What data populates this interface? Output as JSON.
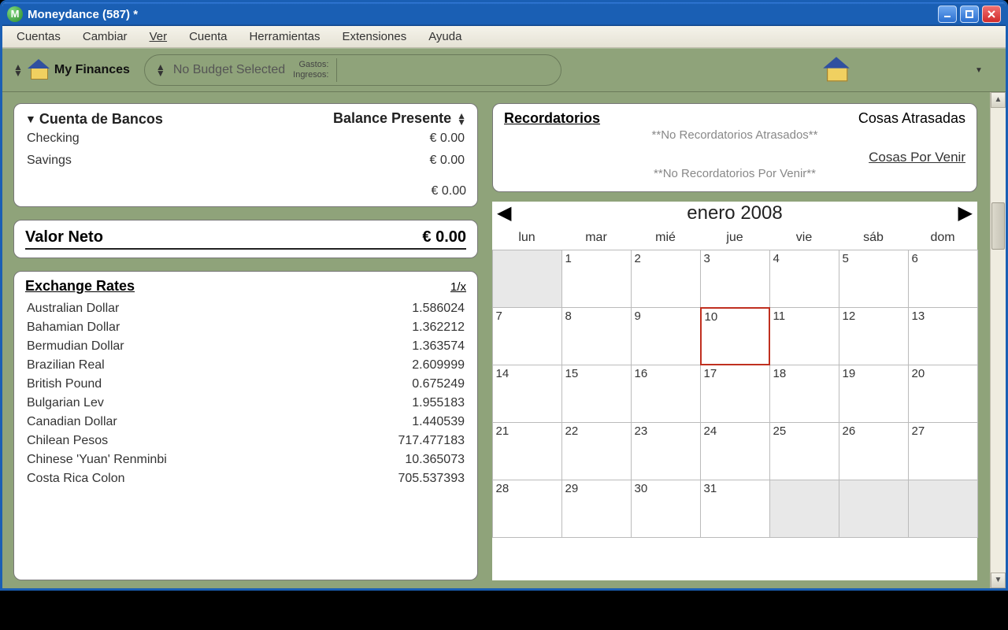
{
  "window": {
    "app_icon_letter": "M",
    "title": "Moneydance (587) *"
  },
  "menu": [
    "Cuentas",
    "Cambiar",
    "Ver",
    "Cuenta",
    "Herramientas",
    "Extensiones",
    "Ayuda"
  ],
  "toolbar": {
    "home_label": "My Finances",
    "budget_selected": "No Budget Selected",
    "gastos_label": "Gastos:",
    "ingresos_label": "Ingresos:"
  },
  "accounts_panel": {
    "title": "Cuenta de Bancos",
    "balance_header": "Balance Presente",
    "rows": [
      {
        "name": "Checking",
        "balance": "€ 0.00"
      },
      {
        "name": "Savings",
        "balance": "€ 0.00"
      }
    ],
    "total": "€ 0.00"
  },
  "networth_panel": {
    "label": "Valor Neto",
    "value": "€ 0.00"
  },
  "fx_panel": {
    "title": "Exchange Rates",
    "inverse_label": "1/x",
    "rows": [
      {
        "name": "Australian Dollar",
        "rate": "1.586024"
      },
      {
        "name": "Bahamian Dollar",
        "rate": "1.362212"
      },
      {
        "name": "Bermudian Dollar",
        "rate": "1.363574"
      },
      {
        "name": "Brazilian Real",
        "rate": "2.609999"
      },
      {
        "name": "British Pound",
        "rate": "0.675249"
      },
      {
        "name": "Bulgarian Lev",
        "rate": "1.955183"
      },
      {
        "name": "Canadian Dollar",
        "rate": "1.440539"
      },
      {
        "name": "Chilean Pesos",
        "rate": "717.477183"
      },
      {
        "name": "Chinese 'Yuan' Renminbi",
        "rate": "10.365073"
      },
      {
        "name": "Costa Rica Colon",
        "rate": "705.537393"
      }
    ]
  },
  "reminders_panel": {
    "title": "Recordatorios",
    "overdue_label": "Cosas Atrasadas",
    "overdue_empty": "**No Recordatorios Atrasados**",
    "upcoming_label": "Cosas Por Venir",
    "upcoming_empty": "**No Recordatorios Por Venir**"
  },
  "calendar": {
    "title": "enero 2008",
    "dow": [
      "lun",
      "mar",
      "mié",
      "jue",
      "vie",
      "sáb",
      "dom"
    ],
    "first_weekday_offset": 1,
    "days_in_month": 31,
    "today": 10
  }
}
